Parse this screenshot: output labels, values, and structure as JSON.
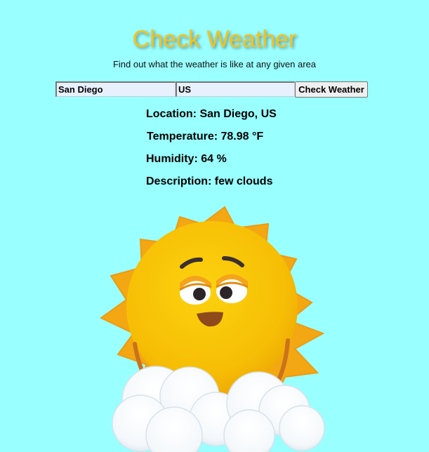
{
  "header": {
    "title": "Check Weather",
    "subtitle": "Find out what the weather is like at any given area"
  },
  "form": {
    "city_value": "San Diego",
    "country_value": "US",
    "submit_label": "Check Weather"
  },
  "result": {
    "location": "Location: San Diego, US",
    "temperature": "Temperature: 78.98 °F",
    "humidity": "Humidity: 64 %",
    "description": "Description: few clouds"
  },
  "illustration": {
    "icon": "sun-behind-clouds-icon"
  },
  "colors": {
    "background": "#99FFFF",
    "title": "#F5C21B",
    "input_background": "#E8F0FE",
    "sun_body": "#F7C407",
    "sun_rays": "#F3A712"
  }
}
